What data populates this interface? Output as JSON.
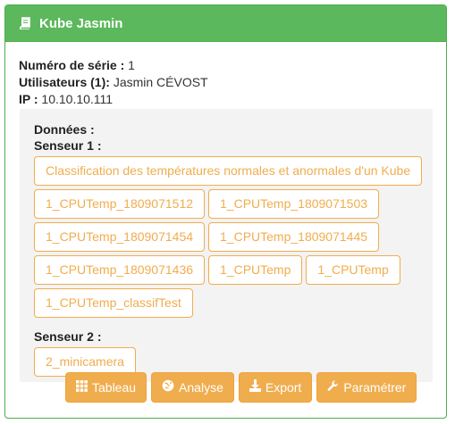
{
  "panel": {
    "title": "Kube Jasmin",
    "icon": "book-icon",
    "color": "#5cb85c"
  },
  "info": {
    "serial_label": "Numéro de série :",
    "serial_value": "1",
    "users_label": "Utilisateurs (1):",
    "users_value": "Jasmin CÉVOST",
    "ip_label": "IP :",
    "ip_value": "10.10.10.111"
  },
  "data_section": {
    "label": "Données :",
    "sensor1": {
      "label": "Senseur 1 :",
      "items": [
        "Classification des températures normales et anormales d'un Kube",
        "1_CPUTemp_1809071512",
        "1_CPUTemp_1809071503",
        "1_CPUTemp_1809071454",
        "1_CPUTemp_1809071445",
        "1_CPUTemp_1809071436",
        "1_CPUTemp",
        "1_CPUTemp",
        "1_CPUTemp_classifTest"
      ]
    },
    "sensor2": {
      "label": "Senseur 2 :",
      "items": [
        "2_minicamera"
      ]
    }
  },
  "actions": {
    "tableau": "Tableau",
    "analyse": "Analyse",
    "export": "Export",
    "parametrer": "Paramétrer",
    "color": "#f0ad4e"
  }
}
